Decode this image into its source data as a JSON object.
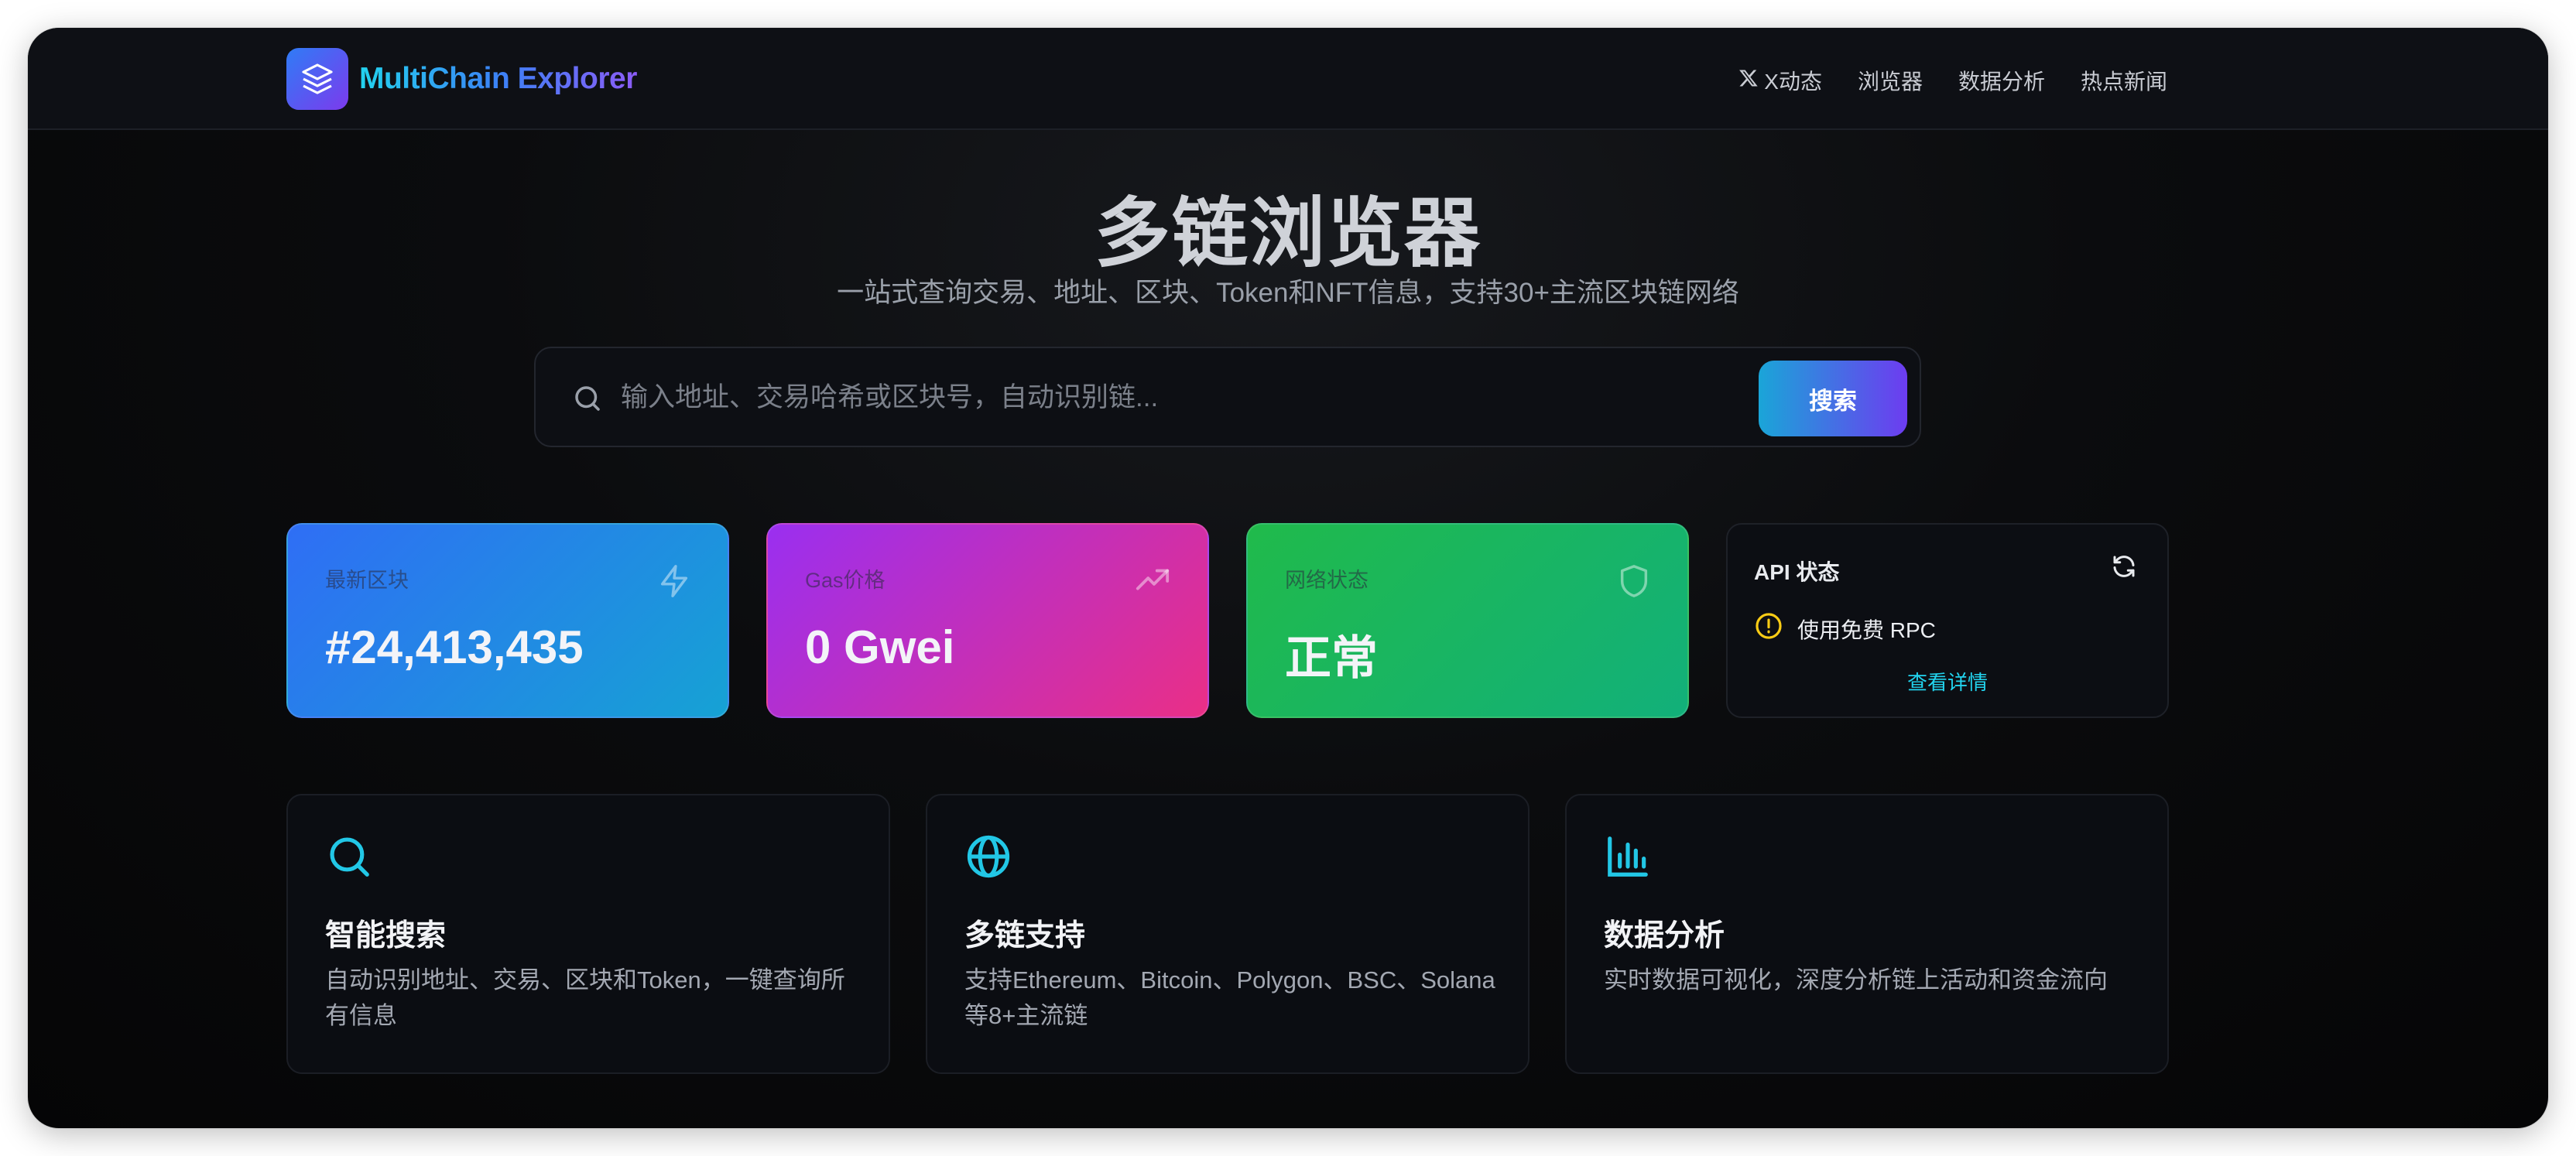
{
  "header": {
    "brand": "MultiChain Explorer",
    "nav": [
      {
        "label": "X动态",
        "icon": "x-logo-icon"
      },
      {
        "label": "浏览器"
      },
      {
        "label": "数据分析"
      },
      {
        "label": "热点新闻"
      }
    ]
  },
  "hero": {
    "title": "多链浏览器",
    "subtitle": "一站式查询交易、地址、区块、Token和NFT信息，支持30+主流区块链网络"
  },
  "search": {
    "placeholder": "输入地址、交易哈希或区块号，自动识别链...",
    "button": "搜索"
  },
  "stats": [
    {
      "label": "最新区块",
      "value": "#24,413,435",
      "icon": "lightning-icon"
    },
    {
      "label": "Gas价格",
      "value": "0 Gwei",
      "icon": "trending-up-icon"
    },
    {
      "label": "网络状态",
      "value": "正常",
      "icon": "shield-icon"
    }
  ],
  "api": {
    "title": "API 状态",
    "status": "使用免费 RPC",
    "link": "查看详情",
    "icons": [
      "refresh-icon",
      "warning-circle-icon"
    ],
    "status_color": "#facc15"
  },
  "features": [
    {
      "title": "智能搜索",
      "desc": "自动识别地址、交易、区块和Token，一键查询所有信息",
      "icon": "search-icon"
    },
    {
      "title": "多链支持",
      "desc": "支持Ethereum、Bitcoin、Polygon、BSC、Solana等8+主流链",
      "icon": "globe-icon"
    },
    {
      "title": "数据分析",
      "desc": "实时数据可视化，深度分析链上活动和资金流向",
      "icon": "bar-chart-icon"
    }
  ],
  "colors": {
    "accent": "#22d3ee",
    "brand_start": "#3b82f6",
    "brand_end": "#8b5cf6"
  }
}
